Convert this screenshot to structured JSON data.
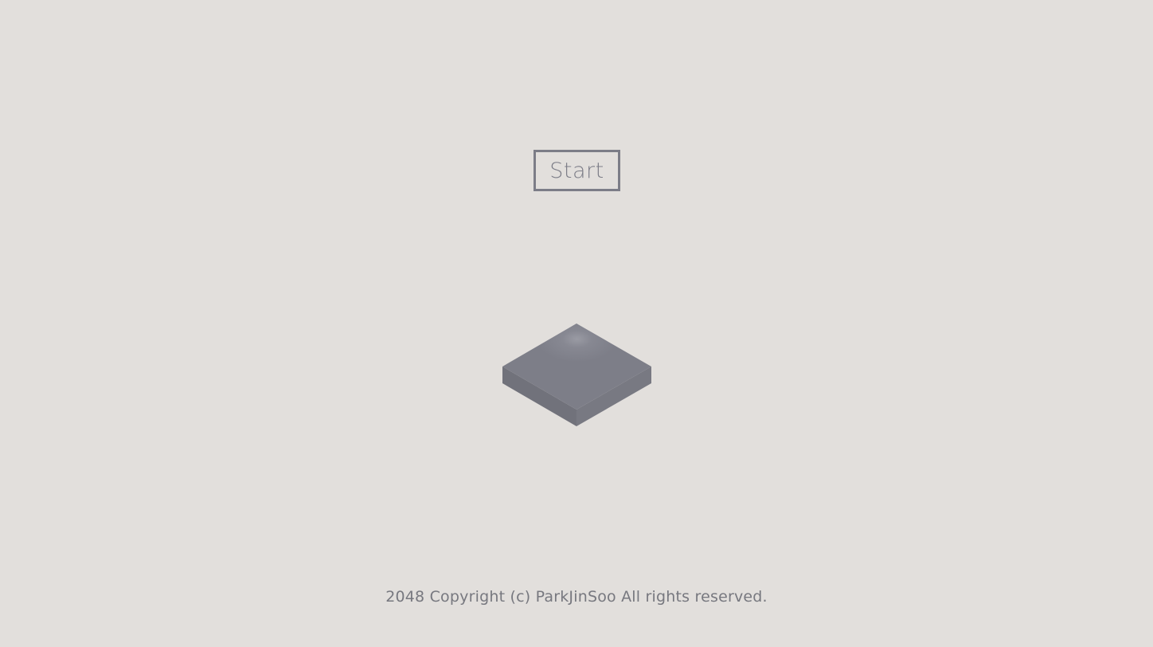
{
  "start_label": "Start",
  "copyright": "2048 Copyright (c) ParkJinSoo All rights reserved.",
  "board": {
    "icon": "isometric-board-tile",
    "top_color": "#7d7e88",
    "left_side_color": "#71727b",
    "right_side_color": "#787982"
  },
  "colors": {
    "background": "#e2dfdc",
    "accent": "#7c7d87",
    "text": "#77787f"
  }
}
